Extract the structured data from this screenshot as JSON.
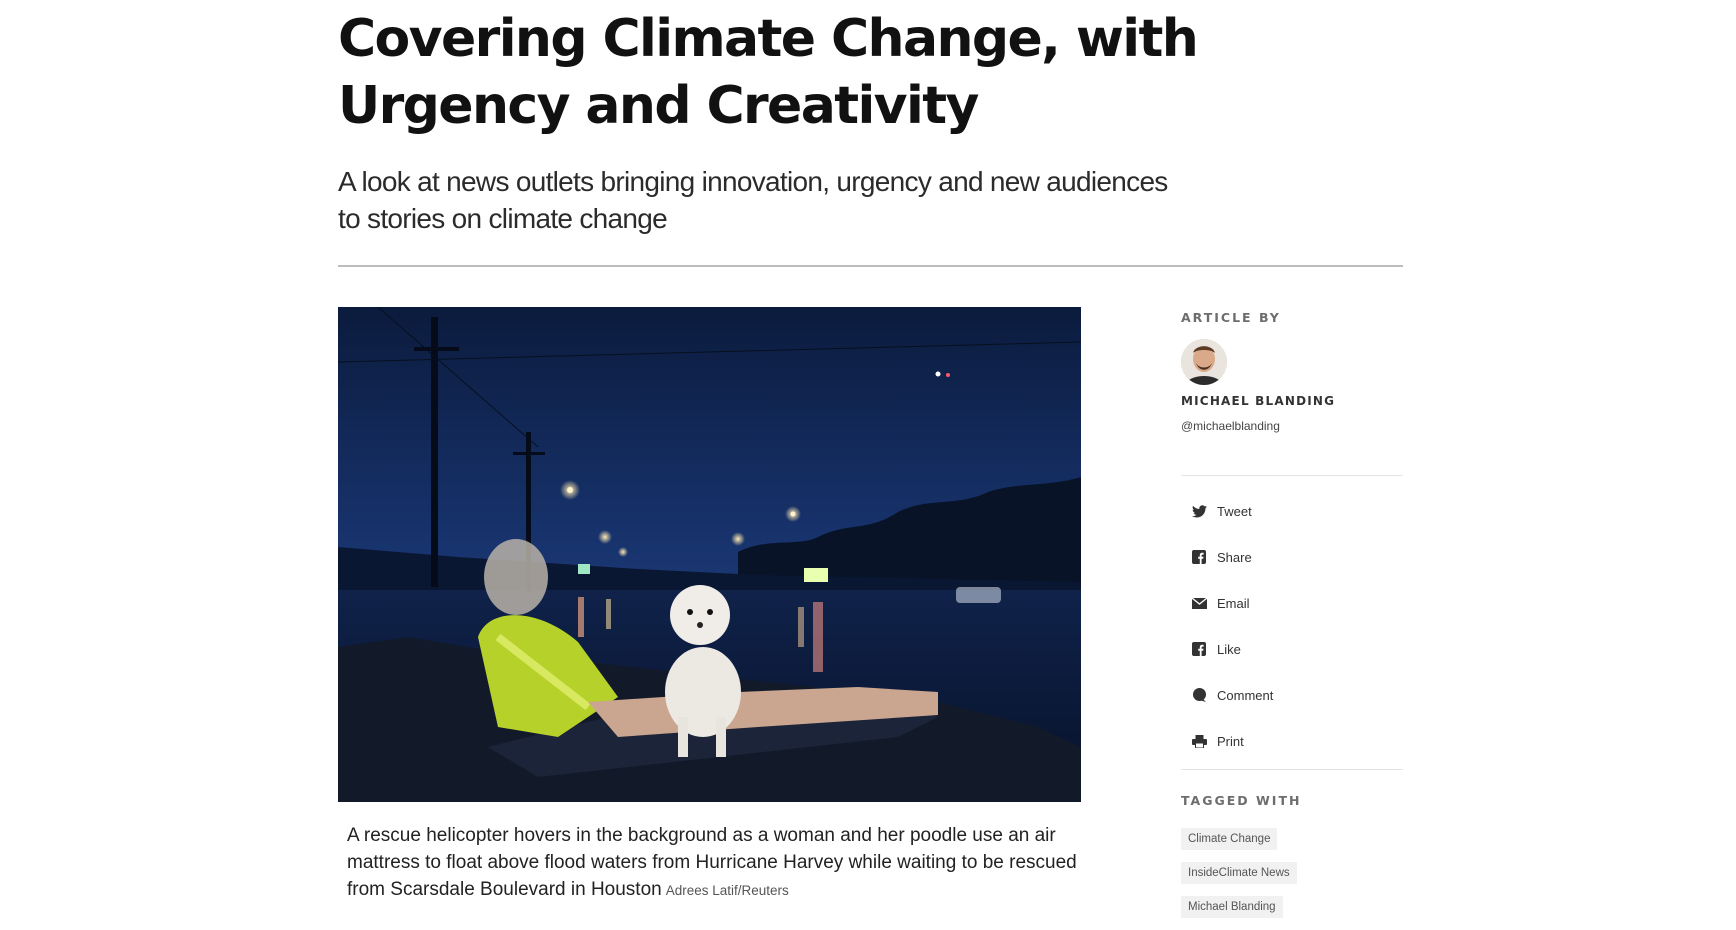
{
  "article": {
    "title": "Covering Climate Change, with Urgency and Creativity",
    "subtitle": "A look at news outlets bringing innovation, urgency and new audiences to stories on climate change"
  },
  "hero": {
    "caption": "A rescue helicopter hovers in the background as a woman and her poodle use an air mattress to float above flood waters from Hurricane Harvey while waiting to be rescued from Scarsdale Boulevard in Houston",
    "credit": "Adrees Latif/Reuters"
  },
  "sidebar": {
    "article_by_label": "ARTICLE BY",
    "author_name": "MICHAEL BLANDING",
    "author_handle": "@michaelblanding",
    "share": [
      {
        "label": "Tweet",
        "icon": "twitter-icon"
      },
      {
        "label": "Share",
        "icon": "facebook-icon"
      },
      {
        "label": "Email",
        "icon": "envelope-icon"
      },
      {
        "label": "Like",
        "icon": "facebook-icon"
      },
      {
        "label": "Comment",
        "icon": "comment-icon"
      },
      {
        "label": "Print",
        "icon": "printer-icon"
      }
    ],
    "tagged_label": "TAGGED WITH",
    "tags": [
      "Climate Change",
      "InsideClimate News",
      "Michael Blanding"
    ]
  },
  "colors": {
    "text": "#111111",
    "muted": "#6d6d6d",
    "tag_bg": "#f1f1f1",
    "rule": "#bdbdbd"
  }
}
